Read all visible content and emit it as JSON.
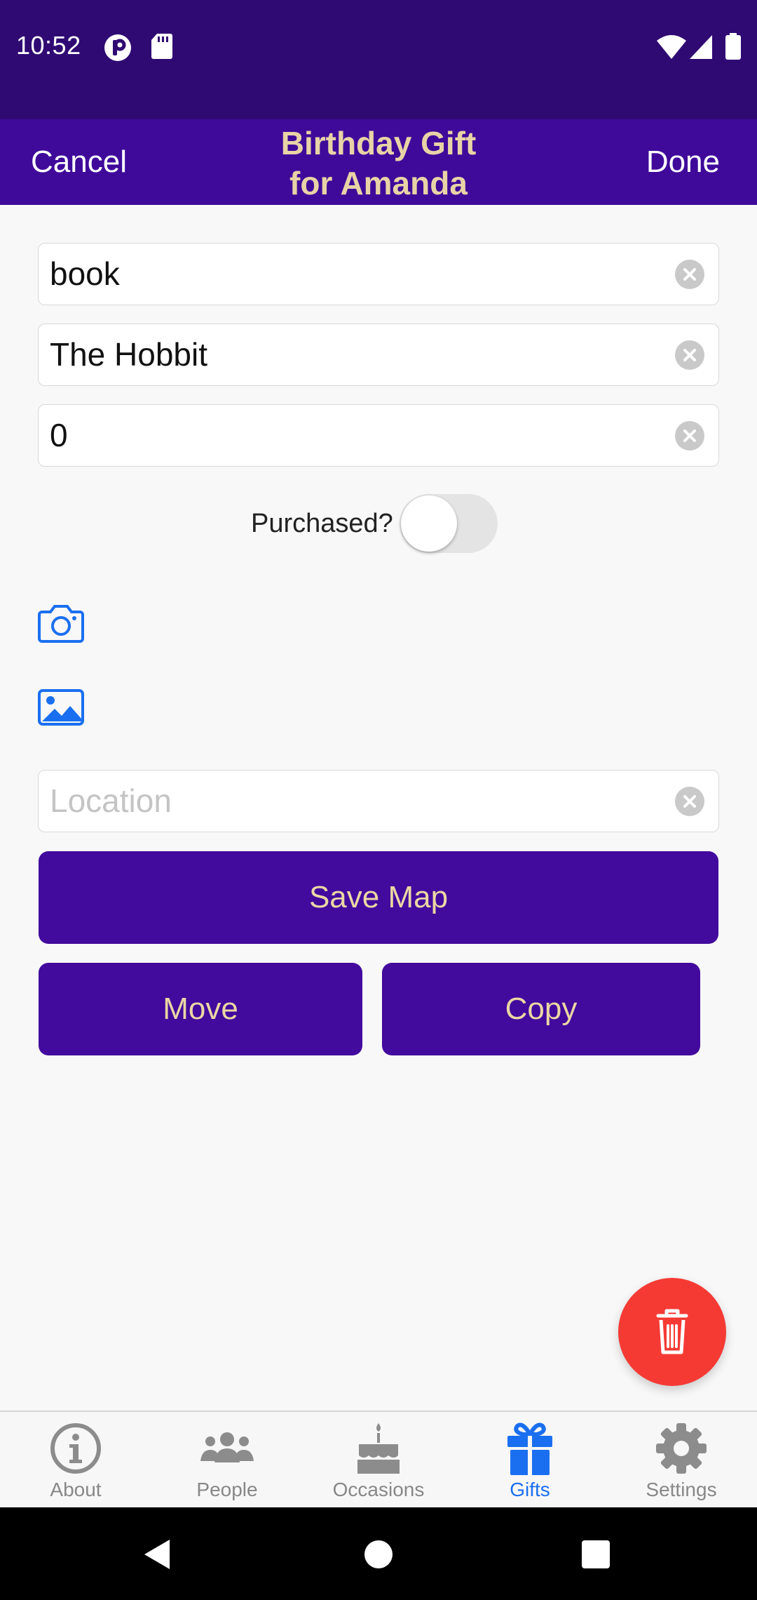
{
  "status_bar": {
    "time": "10:52",
    "icons": [
      "p-icon",
      "sd-card-icon",
      "wifi-icon",
      "signal-icon",
      "battery-icon"
    ]
  },
  "header": {
    "cancel_label": "Cancel",
    "title_line1": "Birthday Gift",
    "title_line2": "for Amanda",
    "done_label": "Done"
  },
  "form": {
    "field1_value": "book",
    "field2_value": "The Hobbit",
    "field3_value": "0",
    "purchased_label": "Purchased?",
    "purchased": false,
    "location_placeholder": "Location",
    "location_value": ""
  },
  "buttons": {
    "save_map": "Save Map",
    "move": "Move",
    "copy": "Copy"
  },
  "fab": {
    "icon": "trash-icon"
  },
  "tabs": [
    {
      "label": "About",
      "icon": "info-icon",
      "active": false
    },
    {
      "label": "People",
      "icon": "people-icon",
      "active": false
    },
    {
      "label": "Occasions",
      "icon": "cake-icon",
      "active": false
    },
    {
      "label": "Gifts",
      "icon": "gift-icon",
      "active": true
    },
    {
      "label": "Settings",
      "icon": "gear-icon",
      "active": false
    }
  ],
  "colors": {
    "status_bar": "#2f0a73",
    "header": "#3f0a9a",
    "title": "#e8d3a6",
    "button_bg": "#420a9d",
    "button_text": "#ead7a4",
    "accent_blue": "#1a6ff0",
    "fab": "#f53a34"
  }
}
